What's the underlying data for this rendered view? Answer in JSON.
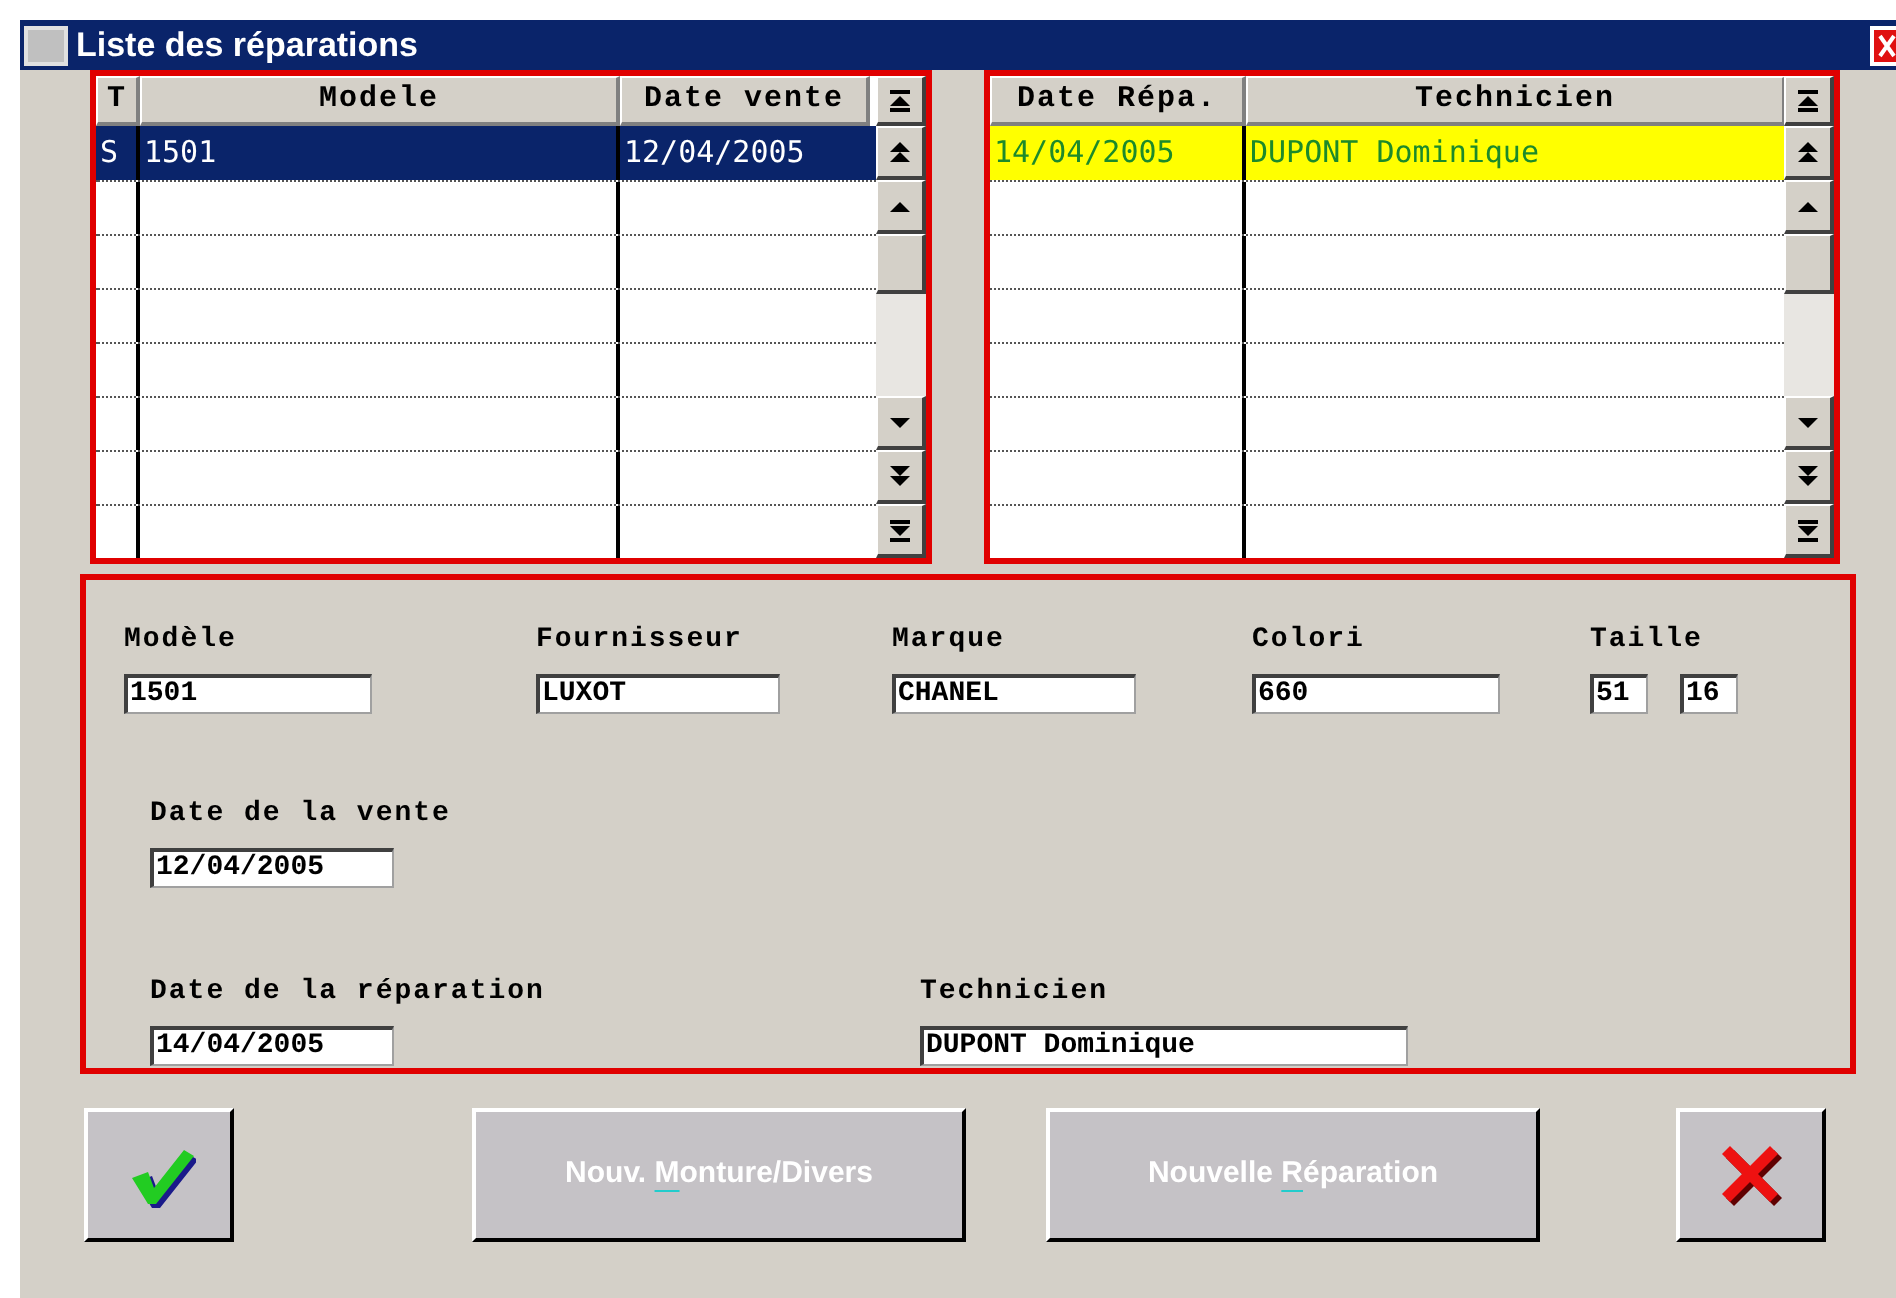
{
  "window": {
    "title": "Liste des réparations"
  },
  "sales_grid": {
    "focused": true,
    "columns": [
      "T",
      "Modele",
      "Date vente"
    ],
    "rows": [
      {
        "cells": [
          "S",
          "1501",
          "12/04/2005"
        ],
        "selected": true
      }
    ]
  },
  "repairs_grid": {
    "focused": false,
    "columns": [
      "Date Répa.",
      "Technicien"
    ],
    "rows": [
      {
        "cells": [
          "14/04/2005",
          "DUPONT Dominique"
        ],
        "selected": true
      }
    ]
  },
  "details": {
    "fields": [
      {
        "label": "Modèle",
        "values": [
          "1501"
        ]
      },
      {
        "label": "Fournisseur",
        "values": [
          "LUXOT"
        ]
      },
      {
        "label": "Marque",
        "values": [
          "CHANEL"
        ]
      },
      {
        "label": "Colori",
        "values": [
          "660"
        ]
      },
      {
        "label": "Taille",
        "values": [
          "51",
          "16"
        ]
      },
      {
        "label": "Date de la vente",
        "values": [
          "12/04/2005"
        ]
      },
      {
        "label": "Date de la réparation",
        "values": [
          "14/04/2005"
        ]
      },
      {
        "label": "Technicien",
        "values": [
          "DUPONT Dominique"
        ]
      }
    ]
  },
  "buttons": [
    {
      "kind": "ok",
      "disabled": false
    },
    {
      "kind": "text",
      "label_before": "Nouv. ",
      "mnemonic": "M",
      "label_after": "onture/Divers",
      "disabled": true
    },
    {
      "kind": "text",
      "label_before": "Nouvelle ",
      "mnemonic": "R",
      "label_after": "éparation",
      "disabled": true
    },
    {
      "kind": "cancel",
      "disabled": false
    }
  ]
}
